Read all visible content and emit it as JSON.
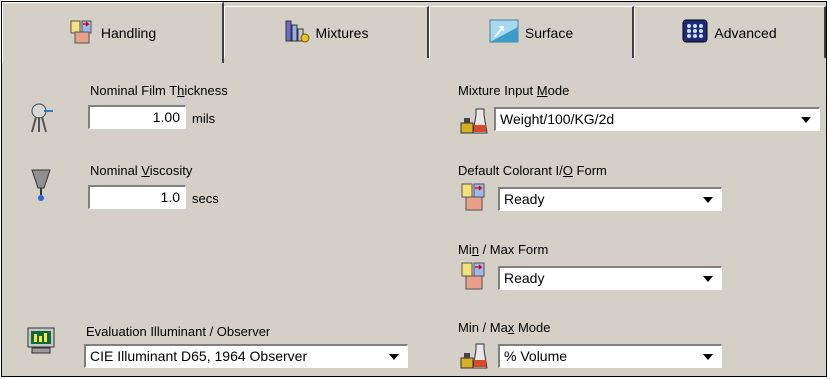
{
  "tabs": [
    {
      "label": "Handling",
      "icon": "mixture-beakers-icon",
      "active": true
    },
    {
      "label": "Mixtures",
      "icon": "mixtures-bars-icon",
      "active": false
    },
    {
      "label": "Surface",
      "icon": "surface-icon",
      "active": false
    },
    {
      "label": "Advanced",
      "icon": "advanced-grid-icon",
      "active": false
    }
  ],
  "film": {
    "label_pre": "Nominal Film T",
    "label_ul": "h",
    "label_post": "ickness",
    "value": "1.00",
    "unit": "mils",
    "icon": "spray-gun-icon"
  },
  "viscosity": {
    "label_pre": "Nominal ",
    "label_ul": "V",
    "label_post": "iscosity",
    "value": "1.0",
    "unit": "secs",
    "icon": "viscosity-cup-icon"
  },
  "illuminant": {
    "label": "Evaluation Illuminant / Observer",
    "value": "CIE Illuminant D65, 1964 Observer",
    "icon": "monitor-icon"
  },
  "mixture_input": {
    "label_pre": "Mixture Input ",
    "label_ul": "M",
    "label_post": "ode",
    "value": "Weight/100/KG/2d",
    "icon": "scale-flask-icon"
  },
  "colorant_form": {
    "label_pre": "Default Colorant I/",
    "label_ul": "O",
    "label_post": " Form",
    "value": "Ready",
    "icon": "mixture-beakers-icon"
  },
  "minmax_form": {
    "label_pre": "Mi",
    "label_ul": "n",
    "label_post": " / Max Form",
    "value": "Ready",
    "icon": "mixture-beakers-icon"
  },
  "minmax_mode": {
    "label_pre": "Min / Ma",
    "label_ul": "x",
    "label_post": " Mode",
    "value": "% Volume",
    "icon": "scale-flask-icon"
  }
}
